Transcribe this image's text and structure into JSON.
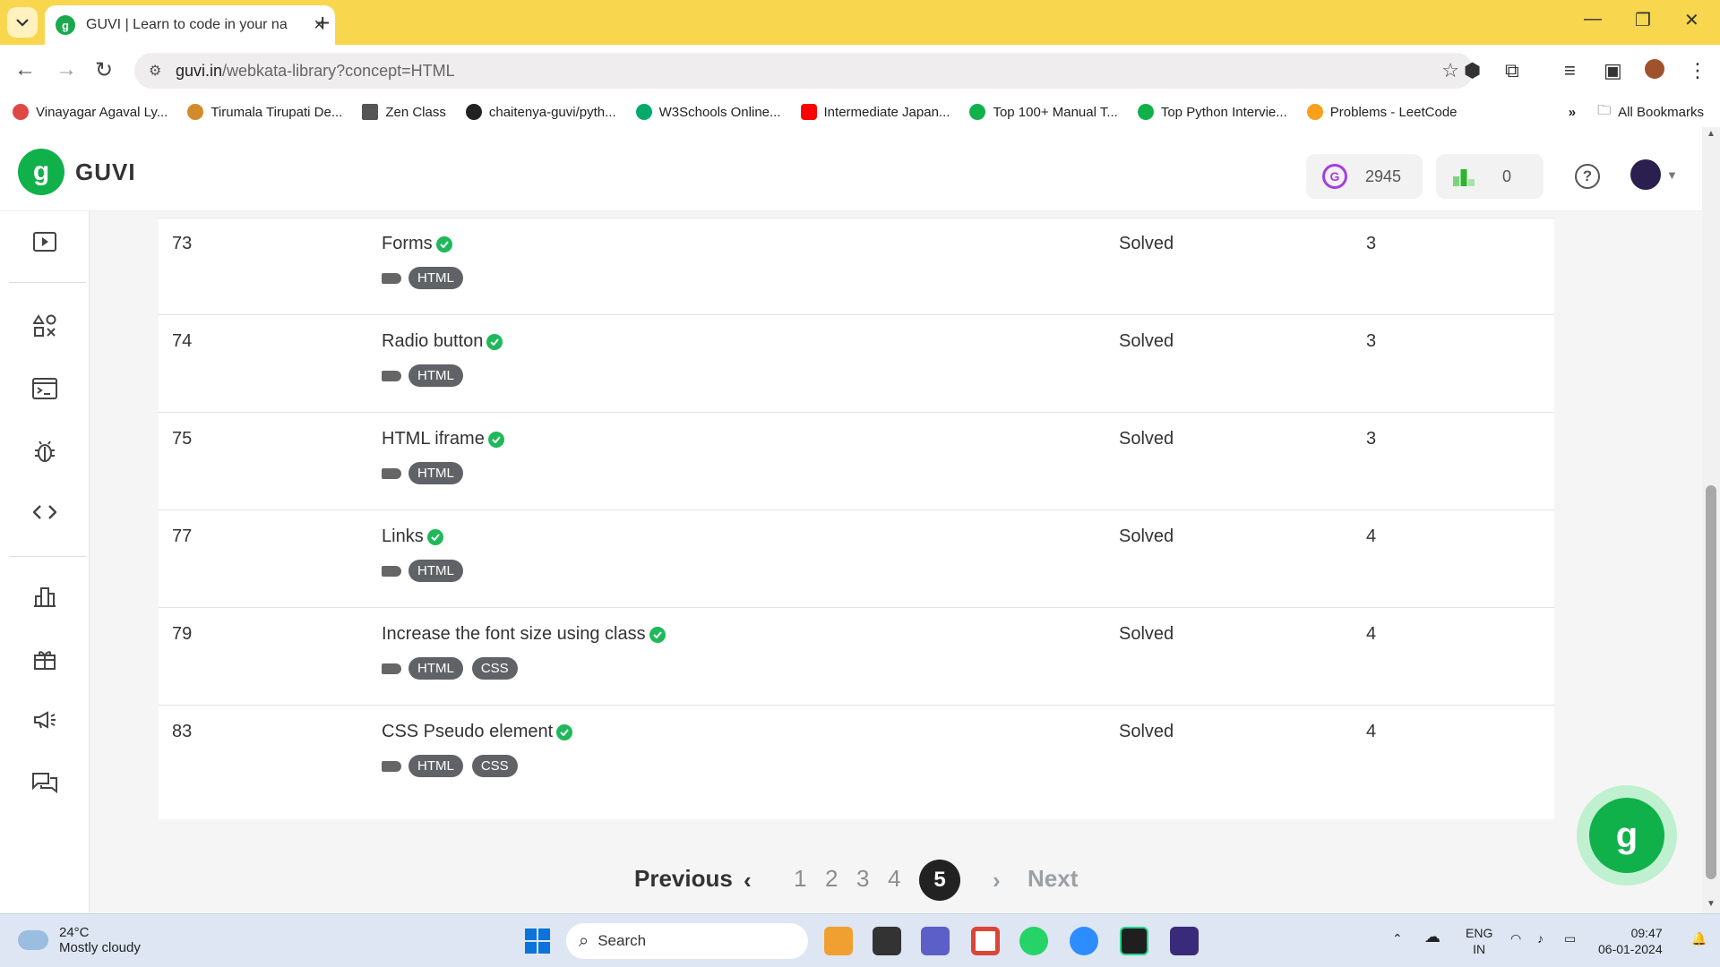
{
  "browser": {
    "tab_title": "GUVI | Learn to code in your na",
    "tab_favicon": "g",
    "url_host": "guvi.in",
    "url_path": "/webkata-library?concept=HTML",
    "bookmarks": [
      {
        "label": "Vinayagar Agaval Ly...",
        "color": "#e04848"
      },
      {
        "label": "Tirumala Tirupati De...",
        "color": "#d28b2a"
      },
      {
        "label": "Zen Class",
        "color": "#555555"
      },
      {
        "label": "chaitenya-guvi/pyth...",
        "color": "#222222"
      },
      {
        "label": "W3Schools Online...",
        "color": "#04aa6d"
      },
      {
        "label": "Intermediate Japan...",
        "color": "#ff0000"
      },
      {
        "label": "Top 100+ Manual T...",
        "color": "#10b14a"
      },
      {
        "label": "Top Python Intervie...",
        "color": "#10b14a"
      },
      {
        "label": "Problems - LeetCode",
        "color": "#f89f1b"
      }
    ],
    "all_bookmarks": "All Bookmarks"
  },
  "header": {
    "brand": "GUVI",
    "logo_glyph": "g",
    "gems": "2945",
    "rank": "0"
  },
  "rows": [
    {
      "id": "73",
      "title": "Forms",
      "status": "Solved",
      "score": "3",
      "tags": [
        "HTML"
      ]
    },
    {
      "id": "74",
      "title": "Radio button",
      "status": "Solved",
      "score": "3",
      "tags": [
        "HTML"
      ]
    },
    {
      "id": "75",
      "title": "HTML iframe",
      "status": "Solved",
      "score": "3",
      "tags": [
        "HTML"
      ]
    },
    {
      "id": "77",
      "title": "Links",
      "status": "Solved",
      "score": "4",
      "tags": [
        "HTML"
      ]
    },
    {
      "id": "79",
      "title": "Increase the font size using class",
      "status": "Solved",
      "score": "4",
      "tags": [
        "HTML",
        "CSS"
      ]
    },
    {
      "id": "83",
      "title": "CSS Pseudo element",
      "status": "Solved",
      "score": "4",
      "tags": [
        "HTML",
        "CSS"
      ]
    }
  ],
  "pagination": {
    "previous": "Previous",
    "next": "Next",
    "pages": [
      "1",
      "2",
      "3",
      "4"
    ],
    "current": "5"
  },
  "taskbar": {
    "temp": "24°C",
    "weather": "Mostly cloudy",
    "search": "Search",
    "lang1": "ENG",
    "lang2": "IN",
    "time": "09:47",
    "date": "06-01-2024"
  }
}
